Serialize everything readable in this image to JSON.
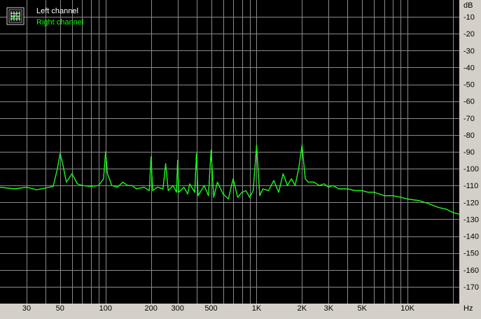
{
  "chart_data": {
    "type": "line",
    "title": "",
    "xlabel": "",
    "ylabel": "",
    "x_unit": "Hz",
    "y_unit": "dB",
    "x_scale": "log",
    "xlim": [
      20,
      22000
    ],
    "ylim": [
      -180,
      0
    ],
    "grid": true,
    "legend_position": "top-left",
    "x_ticks": [
      {
        "value": 30,
        "label": "30"
      },
      {
        "value": 50,
        "label": "50"
      },
      {
        "value": 100,
        "label": "100"
      },
      {
        "value": 200,
        "label": "200"
      },
      {
        "value": 300,
        "label": "300"
      },
      {
        "value": 500,
        "label": "500"
      },
      {
        "value": 1000,
        "label": "1K"
      },
      {
        "value": 2000,
        "label": "2K"
      },
      {
        "value": 3000,
        "label": "3K"
      },
      {
        "value": 5000,
        "label": "5K"
      },
      {
        "value": 10000,
        "label": "10K"
      }
    ],
    "y_ticks": [
      {
        "value": -10,
        "label": "-10"
      },
      {
        "value": -20,
        "label": "-20"
      },
      {
        "value": -30,
        "label": "-30"
      },
      {
        "value": -40,
        "label": "-40"
      },
      {
        "value": -50,
        "label": "-50"
      },
      {
        "value": -60,
        "label": "-60"
      },
      {
        "value": -70,
        "label": "-70"
      },
      {
        "value": -80,
        "label": "-80"
      },
      {
        "value": -90,
        "label": "-90"
      },
      {
        "value": -100,
        "label": "-100"
      },
      {
        "value": -110,
        "label": "-110"
      },
      {
        "value": -120,
        "label": "-120"
      },
      {
        "value": -130,
        "label": "-130"
      },
      {
        "value": -140,
        "label": "-140"
      },
      {
        "value": -150,
        "label": "-150"
      },
      {
        "value": -160,
        "label": "-160"
      },
      {
        "value": -170,
        "label": "-170"
      }
    ],
    "series": [
      {
        "name": "Left channel",
        "color": "#ffffff",
        "points": [
          [
            20,
            -111
          ],
          [
            25,
            -112
          ],
          [
            30,
            -111
          ],
          [
            35,
            -112.5
          ],
          [
            40,
            -111.5
          ],
          [
            45,
            -110.5
          ],
          [
            48,
            -100
          ],
          [
            50,
            -91
          ],
          [
            52,
            -97
          ],
          [
            55,
            -108
          ],
          [
            60,
            -103
          ],
          [
            65,
            -109
          ],
          [
            70,
            -110
          ],
          [
            80,
            -110.5
          ],
          [
            90,
            -110
          ],
          [
            97,
            -106
          ],
          [
            100,
            -90
          ],
          [
            103,
            -103
          ],
          [
            110,
            -110
          ],
          [
            120,
            -111
          ],
          [
            130,
            -108
          ],
          [
            140,
            -110
          ],
          [
            150,
            -110
          ],
          [
            160,
            -112
          ],
          [
            180,
            -111
          ],
          [
            195,
            -113
          ],
          [
            200,
            -93
          ],
          [
            205,
            -113
          ],
          [
            220,
            -111
          ],
          [
            240,
            -112
          ],
          [
            250,
            -97
          ],
          [
            260,
            -113
          ],
          [
            280,
            -110
          ],
          [
            295,
            -114
          ],
          [
            300,
            -95
          ],
          [
            305,
            -114
          ],
          [
            330,
            -111
          ],
          [
            350,
            -115
          ],
          [
            360,
            -109
          ],
          [
            390,
            -114
          ],
          [
            400,
            -91
          ],
          [
            410,
            -116
          ],
          [
            450,
            -110
          ],
          [
            480,
            -116
          ],
          [
            500,
            -89
          ],
          [
            520,
            -117
          ],
          [
            550,
            -108
          ],
          [
            600,
            -115
          ],
          [
            650,
            -118
          ],
          [
            700,
            -106
          ],
          [
            750,
            -117
          ],
          [
            800,
            -114
          ],
          [
            850,
            -113
          ],
          [
            900,
            -117
          ],
          [
            950,
            -113
          ],
          [
            1000,
            -86
          ],
          [
            1050,
            -116
          ],
          [
            1100,
            -112
          ],
          [
            1200,
            -113
          ],
          [
            1300,
            -107
          ],
          [
            1400,
            -114
          ],
          [
            1500,
            -103
          ],
          [
            1600,
            -110
          ],
          [
            1700,
            -106
          ],
          [
            1800,
            -110
          ],
          [
            1900,
            -100
          ],
          [
            2000,
            -86
          ],
          [
            2100,
            -106
          ],
          [
            2200,
            -108
          ],
          [
            2400,
            -108
          ],
          [
            2600,
            -110
          ],
          [
            2800,
            -109
          ],
          [
            3000,
            -111
          ],
          [
            3200,
            -110
          ],
          [
            3500,
            -112
          ],
          [
            4000,
            -112
          ],
          [
            4500,
            -113
          ],
          [
            5000,
            -113
          ],
          [
            5500,
            -114
          ],
          [
            6000,
            -114
          ],
          [
            7000,
            -116
          ],
          [
            8000,
            -116
          ],
          [
            9000,
            -117
          ],
          [
            10000,
            -118
          ],
          [
            12000,
            -119
          ],
          [
            14000,
            -121
          ],
          [
            16000,
            -123
          ],
          [
            18000,
            -124
          ],
          [
            20000,
            -126
          ],
          [
            22000,
            -127
          ]
        ]
      },
      {
        "name": "Right channel",
        "color": "#00ff00",
        "points": [
          [
            20,
            -111
          ],
          [
            25,
            -112
          ],
          [
            30,
            -111
          ],
          [
            35,
            -112.5
          ],
          [
            40,
            -111.5
          ],
          [
            45,
            -110.5
          ],
          [
            48,
            -100
          ],
          [
            50,
            -91
          ],
          [
            52,
            -97
          ],
          [
            55,
            -108
          ],
          [
            60,
            -103
          ],
          [
            65,
            -109
          ],
          [
            70,
            -110
          ],
          [
            80,
            -110.5
          ],
          [
            90,
            -110
          ],
          [
            97,
            -106
          ],
          [
            100,
            -90
          ],
          [
            103,
            -103
          ],
          [
            110,
            -110
          ],
          [
            120,
            -111
          ],
          [
            130,
            -108
          ],
          [
            140,
            -110
          ],
          [
            150,
            -110
          ],
          [
            160,
            -112
          ],
          [
            180,
            -111
          ],
          [
            195,
            -113
          ],
          [
            200,
            -93
          ],
          [
            205,
            -113
          ],
          [
            220,
            -111
          ],
          [
            240,
            -112
          ],
          [
            250,
            -97
          ],
          [
            260,
            -113
          ],
          [
            280,
            -110
          ],
          [
            295,
            -114
          ],
          [
            300,
            -95
          ],
          [
            305,
            -114
          ],
          [
            330,
            -111
          ],
          [
            350,
            -115
          ],
          [
            360,
            -109
          ],
          [
            390,
            -114
          ],
          [
            400,
            -91
          ],
          [
            410,
            -116
          ],
          [
            450,
            -110
          ],
          [
            480,
            -116
          ],
          [
            500,
            -89
          ],
          [
            520,
            -117
          ],
          [
            550,
            -108
          ],
          [
            600,
            -115
          ],
          [
            650,
            -118
          ],
          [
            700,
            -106
          ],
          [
            750,
            -117
          ],
          [
            800,
            -114
          ],
          [
            850,
            -113
          ],
          [
            900,
            -117
          ],
          [
            950,
            -113
          ],
          [
            1000,
            -86
          ],
          [
            1050,
            -116
          ],
          [
            1100,
            -112
          ],
          [
            1200,
            -113
          ],
          [
            1300,
            -107
          ],
          [
            1400,
            -114
          ],
          [
            1500,
            -103
          ],
          [
            1600,
            -110
          ],
          [
            1700,
            -106
          ],
          [
            1800,
            -110
          ],
          [
            1900,
            -100
          ],
          [
            2000,
            -86
          ],
          [
            2100,
            -106
          ],
          [
            2200,
            -108
          ],
          [
            2400,
            -108
          ],
          [
            2600,
            -110
          ],
          [
            2800,
            -109
          ],
          [
            3000,
            -111
          ],
          [
            3200,
            -110
          ],
          [
            3500,
            -112
          ],
          [
            4000,
            -112
          ],
          [
            4500,
            -113
          ],
          [
            5000,
            -113
          ],
          [
            5500,
            -114
          ],
          [
            6000,
            -114
          ],
          [
            7000,
            -116
          ],
          [
            8000,
            -116
          ],
          [
            9000,
            -117
          ],
          [
            10000,
            -118
          ],
          [
            12000,
            -119
          ],
          [
            14000,
            -121
          ],
          [
            16000,
            -123
          ],
          [
            18000,
            -124
          ],
          [
            20000,
            -126
          ],
          [
            22000,
            -127
          ]
        ]
      }
    ]
  },
  "colors": {
    "plot_background": "#000000",
    "frame_background": "#d4d0c8",
    "grid": "#8a8a8a",
    "axis_text": "#000000"
  }
}
